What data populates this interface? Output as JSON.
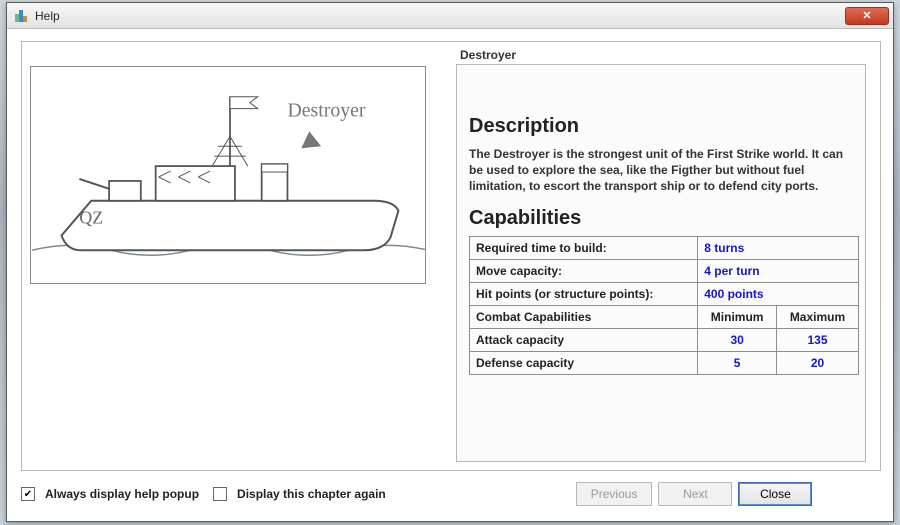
{
  "window": {
    "title": "Help"
  },
  "unit": {
    "name": "Destroyer",
    "image_label": "Destroyer",
    "hull_mark": "QZ"
  },
  "sections": {
    "description_heading": "Description",
    "description_text": "The Destroyer is the strongest unit of the First Strike world. It can be used to explore the sea, like the Figther but without fuel limitation, to escort the transport ship or to defend city ports.",
    "capabilities_heading": "Capabilities"
  },
  "caps_table": {
    "rows_kv": [
      {
        "label": "Required time to build:",
        "value": "8 turns"
      },
      {
        "label": "Move capacity:",
        "value": "4 per turn"
      },
      {
        "label": "Hit points (or structure points):",
        "value": "400 points"
      }
    ],
    "combat_header": {
      "label": "Combat Capabilities",
      "min": "Minimum",
      "max": "Maximum"
    },
    "combat_rows": [
      {
        "label": "Attack capacity",
        "min": "30",
        "max": "135"
      },
      {
        "label": "Defense capacity",
        "min": "5",
        "max": "20"
      }
    ]
  },
  "footer": {
    "check1_label": "Always display help popup",
    "check1_checked": true,
    "check2_label": "Display this chapter again",
    "check2_checked": false,
    "prev": "Previous",
    "next": "Next",
    "close": "Close"
  },
  "icons": {
    "close_glyph": "✕",
    "check_glyph": "✔"
  }
}
